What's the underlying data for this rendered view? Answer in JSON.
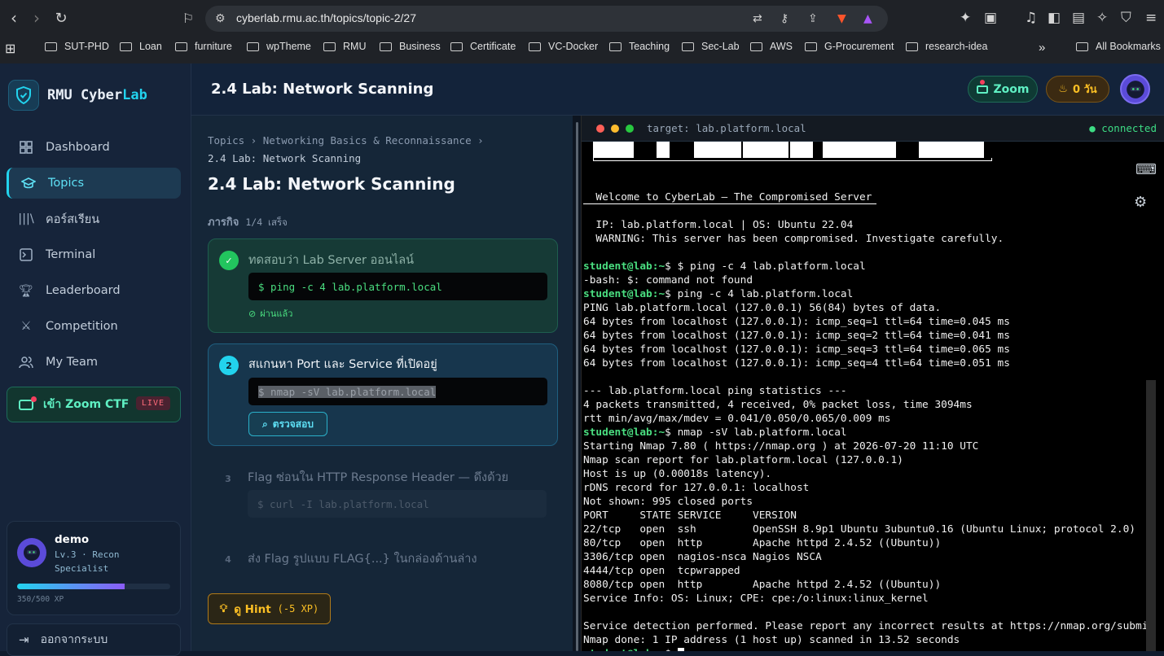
{
  "browser": {
    "url": "cyberlab.rmu.ac.th/topics/topic-2/27",
    "bookmarks": [
      "SUT-PHD",
      "Loan",
      "furniture",
      "wpTheme",
      "RMU",
      "Business",
      "Certificate",
      "VC-Docker",
      "Teaching",
      "Sec-Lab",
      "AWS",
      "G-Procurement",
      "research-idea"
    ],
    "all_bookmarks": "All Bookmarks",
    "overflow": "»"
  },
  "brand": {
    "name_a": "RMU Cyber",
    "name_b": "Lab"
  },
  "sidebar": {
    "items": [
      {
        "label": "Dashboard",
        "icon": "grid-icon"
      },
      {
        "label": "Topics",
        "icon": "graduation-cap-icon"
      },
      {
        "label": "คอร์สเรียน",
        "icon": "books-icon"
      },
      {
        "label": "Terminal",
        "icon": "terminal-icon"
      },
      {
        "label": "Leaderboard",
        "icon": "trophy-icon"
      },
      {
        "label": "Competition",
        "icon": "swords-icon"
      },
      {
        "label": "My Team",
        "icon": "users-icon"
      }
    ],
    "zoom_ctf": "เข้า Zoom CTF",
    "live": "LIVE",
    "user": {
      "name": "demo",
      "level": "Lv.3 · Recon Specialist",
      "xp_text": "350/500 XP",
      "xp_fraction": 0.7
    },
    "logout": "ออกจากระบบ"
  },
  "header": {
    "title": "2.4 Lab: Network Scanning",
    "zoom": "Zoom",
    "streak": "0 วัน"
  },
  "lab": {
    "breadcrumb_1": "Topics › Networking Basics & Reconnaissance ›",
    "breadcrumb_2": "2.4 Lab: Network Scanning",
    "title": "2.4 Lab: Network Scanning",
    "tasks_label": "ภารกิจ",
    "tasks_progress": "1/4 เสร็จ",
    "tasks": [
      {
        "num": "1",
        "title": "ทดสอบว่า Lab Server ออนไลน์",
        "cmd": "$ ping -c 4 lab.platform.local",
        "status": "ผ่านแล้ว"
      },
      {
        "num": "2",
        "title": "สแกนหา Port และ Service ที่เปิดอยู่",
        "cmd": "$ nmap -sV lab.platform.local",
        "button": "ตรวจสอบ"
      },
      {
        "num": "3",
        "title": "Flag ซ่อนใน HTTP Response Header — ดึงด้วย",
        "cmd": "$ curl -I lab.platform.local"
      },
      {
        "num": "4",
        "title": "ส่ง Flag รูปแบบ FLAG{...} ในกล่องด้านล่าง"
      }
    ],
    "hint": "ดู Hint",
    "hint_xp": "(-5 XP)"
  },
  "terminal": {
    "target": "target: lab.platform.local",
    "status": "● connected",
    "prompt": "student@lab",
    "lines": [
      {
        "t": "",
        "p": ""
      },
      {
        "t": "",
        "p": ""
      },
      {
        "t": "  Welcome to CyberLab — The Compromised Server",
        "p": ""
      },
      {
        "t": "",
        "p": ""
      },
      {
        "t": "  IP: lab.platform.local | OS: Ubuntu 22.04",
        "p": ""
      },
      {
        "t": "  WARNING: This server has been compromised. Investigate carefully.",
        "p": ""
      },
      {
        "t": "",
        "p": ""
      },
      {
        "t": "$ $ ping -c 4 lab.platform.local",
        "p": "student@lab:~"
      },
      {
        "t": "-bash: $: command not found",
        "p": ""
      },
      {
        "t": "$ ping -c 4 lab.platform.local",
        "p": "student@lab:~"
      },
      {
        "t": "PING lab.platform.local (127.0.0.1) 56(84) bytes of data.",
        "p": ""
      },
      {
        "t": "64 bytes from localhost (127.0.0.1): icmp_seq=1 ttl=64 time=0.045 ms",
        "p": ""
      },
      {
        "t": "64 bytes from localhost (127.0.0.1): icmp_seq=2 ttl=64 time=0.041 ms",
        "p": ""
      },
      {
        "t": "64 bytes from localhost (127.0.0.1): icmp_seq=3 ttl=64 time=0.065 ms",
        "p": ""
      },
      {
        "t": "64 bytes from localhost (127.0.0.1): icmp_seq=4 ttl=64 time=0.051 ms",
        "p": ""
      },
      {
        "t": "",
        "p": ""
      },
      {
        "t": "--- lab.platform.local ping statistics ---",
        "p": ""
      },
      {
        "t": "4 packets transmitted, 4 received, 0% packet loss, time 3094ms",
        "p": ""
      },
      {
        "t": "rtt min/avg/max/mdev = 0.041/0.050/0.065/0.009 ms",
        "p": ""
      },
      {
        "t": "$ nmap -sV lab.platform.local",
        "p": "student@lab:~"
      },
      {
        "t": "Starting Nmap 7.80 ( https://nmap.org ) at 2026-07-20 11:10 UTC",
        "p": ""
      },
      {
        "t": "Nmap scan report for lab.platform.local (127.0.0.1)",
        "p": ""
      },
      {
        "t": "Host is up (0.00018s latency).",
        "p": ""
      },
      {
        "t": "rDNS record for 127.0.0.1: localhost",
        "p": ""
      },
      {
        "t": "Not shown: 995 closed ports",
        "p": ""
      },
      {
        "t": "PORT     STATE SERVICE     VERSION",
        "p": ""
      },
      {
        "t": "22/tcp   open  ssh         OpenSSH 8.9p1 Ubuntu 3ubuntu0.16 (Ubuntu Linux; protocol 2.0)",
        "p": ""
      },
      {
        "t": "80/tcp   open  http        Apache httpd 2.4.52 ((Ubuntu))",
        "p": ""
      },
      {
        "t": "3306/tcp open  nagios-nsca Nagios NSCA",
        "p": ""
      },
      {
        "t": "4444/tcp open  tcpwrapped",
        "p": ""
      },
      {
        "t": "8080/tcp open  http        Apache httpd 2.4.52 ((Ubuntu))",
        "p": ""
      },
      {
        "t": "Service Info: OS: Linux; CPE: cpe:/o:linux:linux_kernel",
        "p": ""
      },
      {
        "t": "",
        "p": ""
      },
      {
        "t": "Service detection performed. Please report any incorrect results at https://nmap.org/submit/ .",
        "p": ""
      },
      {
        "t": "Nmap done: 1 IP address (1 host up) scanned in 13.52 seconds",
        "p": ""
      },
      {
        "t": "$ ",
        "p": "student@lab:~"
      }
    ]
  },
  "colors": {
    "accent": "#22d3ee",
    "success": "#4ade80",
    "warning": "#fbbf24"
  }
}
